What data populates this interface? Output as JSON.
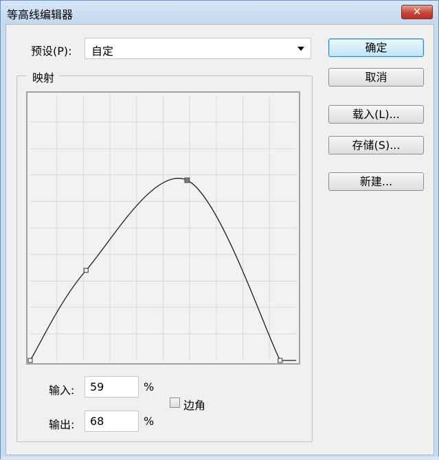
{
  "window": {
    "title": "等高线编辑器",
    "close_label": "✕"
  },
  "preset": {
    "label": "预设(P):",
    "value": "自定"
  },
  "mapping": {
    "group_label": "映射",
    "curve": {
      "input_range": [
        0,
        100
      ],
      "output_range": [
        0,
        100
      ],
      "grid_divisions": 10,
      "control_points": [
        {
          "input": 0,
          "output": 0
        },
        {
          "input": 21,
          "output": 34
        },
        {
          "input": 59,
          "output": 68
        },
        {
          "input": 94,
          "output": 0
        }
      ],
      "selected_point_index": 2,
      "curve_color": "#1a1a1a",
      "grid_color": "#d8d8d8"
    }
  },
  "fields": {
    "input_label": "输入:",
    "input_value": "59",
    "output_label": "输出:",
    "output_value": "68",
    "percent": "%"
  },
  "corner": {
    "label": "边角",
    "checked": false
  },
  "buttons": {
    "ok": "确定",
    "cancel": "取消",
    "load": "载入(L)...",
    "save": "存储(S)...",
    "new": "新建..."
  }
}
